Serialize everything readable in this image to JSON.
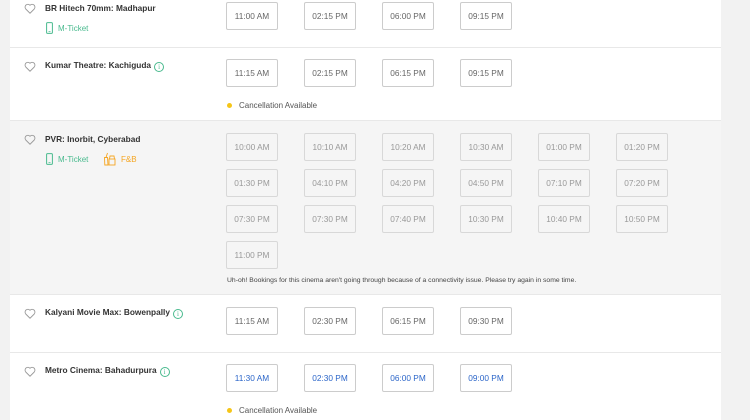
{
  "cinemas": [
    {
      "name": "BR Hitech 70mm: Madhapur",
      "m_ticket": "M-Ticket",
      "showtimes": [
        "11:00 AM",
        "02:15 PM",
        "06:00 PM",
        "09:15 PM"
      ]
    },
    {
      "name": "Kumar Theatre: Kachiguda",
      "info_icon": "i",
      "showtimes": [
        "11:15 AM",
        "02:15 PM",
        "06:15 PM",
        "09:15 PM"
      ],
      "cancellation": "Cancellation Available"
    },
    {
      "name": "PVR: Inorbit, Cyberabad",
      "m_ticket": "M-Ticket",
      "fnb": "F&B",
      "showtimes": [
        "10:00 AM",
        "10:10 AM",
        "10:20 AM",
        "10:30 AM",
        "01:00 PM",
        "01:20 PM",
        "01:30 PM",
        "04:10 PM",
        "04:20 PM",
        "04:50 PM",
        "07:10 PM",
        "07:20 PM",
        "07:30 PM",
        "07:30 PM",
        "07:40 PM",
        "10:30 PM",
        "10:40 PM",
        "10:50 PM",
        "11:00 PM"
      ],
      "notice": "Uh-oh! Bookings for this cinema aren't going through because of a connectivity issue. Please try again in some time."
    },
    {
      "name": "Kalyani Movie Max: Bowenpally",
      "info_icon": "i",
      "showtimes": [
        "11:15 AM",
        "02:30 PM",
        "06:15 PM",
        "09:30 PM"
      ]
    },
    {
      "name": "Metro Cinema: Bahadurpura",
      "info_icon": "i",
      "showtimes": [
        "11:30 AM",
        "02:30 PM",
        "06:00 PM",
        "09:00 PM"
      ],
      "cancellation": "Cancellation Available"
    }
  ],
  "colors": {
    "available_showtime": "#2c66c9",
    "m_ticket": "#49ba8e",
    "fnb": "#f5a623",
    "cancellation_dot": "#f5c518"
  },
  "icons": {
    "favorite": "heart-icon",
    "m_ticket": "mobile-phone-icon",
    "fnb": "food-beverage-icon",
    "info": "info-icon",
    "cancellation": "dot-icon"
  }
}
